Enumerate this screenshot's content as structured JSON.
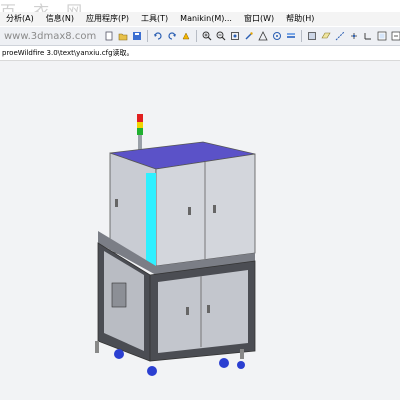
{
  "watermark": "百 衣 网",
  "menu": {
    "items": [
      "分析(A)",
      "信息(N)",
      "应用程序(P)",
      "工具(T)",
      "Manikin(M)...",
      "窗口(W)",
      "帮助(H)"
    ]
  },
  "toolbar": {
    "url_text": "www.3dmax8.com",
    "icons": [
      "new-icon",
      "open-icon",
      "save-icon",
      "undo-icon",
      "redo-icon",
      "regenerate-icon",
      "zoom-in-icon",
      "zoom-out-icon",
      "refit-icon",
      "repaint-icon",
      "orient-icon",
      "spin-icon",
      "layer-icon",
      "display-style-icon",
      "datum-plane-icon",
      "datum-axis-icon",
      "datum-point-icon",
      "coordinate-system-icon",
      "view-manager-icon",
      "saved-views-icon",
      "help-icon"
    ]
  },
  "message": {
    "text": "proeWildfire 3.0\\text\\yanxiu.cfg读取。"
  },
  "colors": {
    "accent": "#2ff0ff",
    "top_panel": "#5b52c8",
    "frame": "#7b7e86",
    "panel": "#c9ccd3",
    "base": "#4b4d53",
    "signal_red": "#e11f1f",
    "signal_yellow": "#f2d400",
    "signal_green": "#20b030",
    "caster": "#2b3fd1"
  }
}
